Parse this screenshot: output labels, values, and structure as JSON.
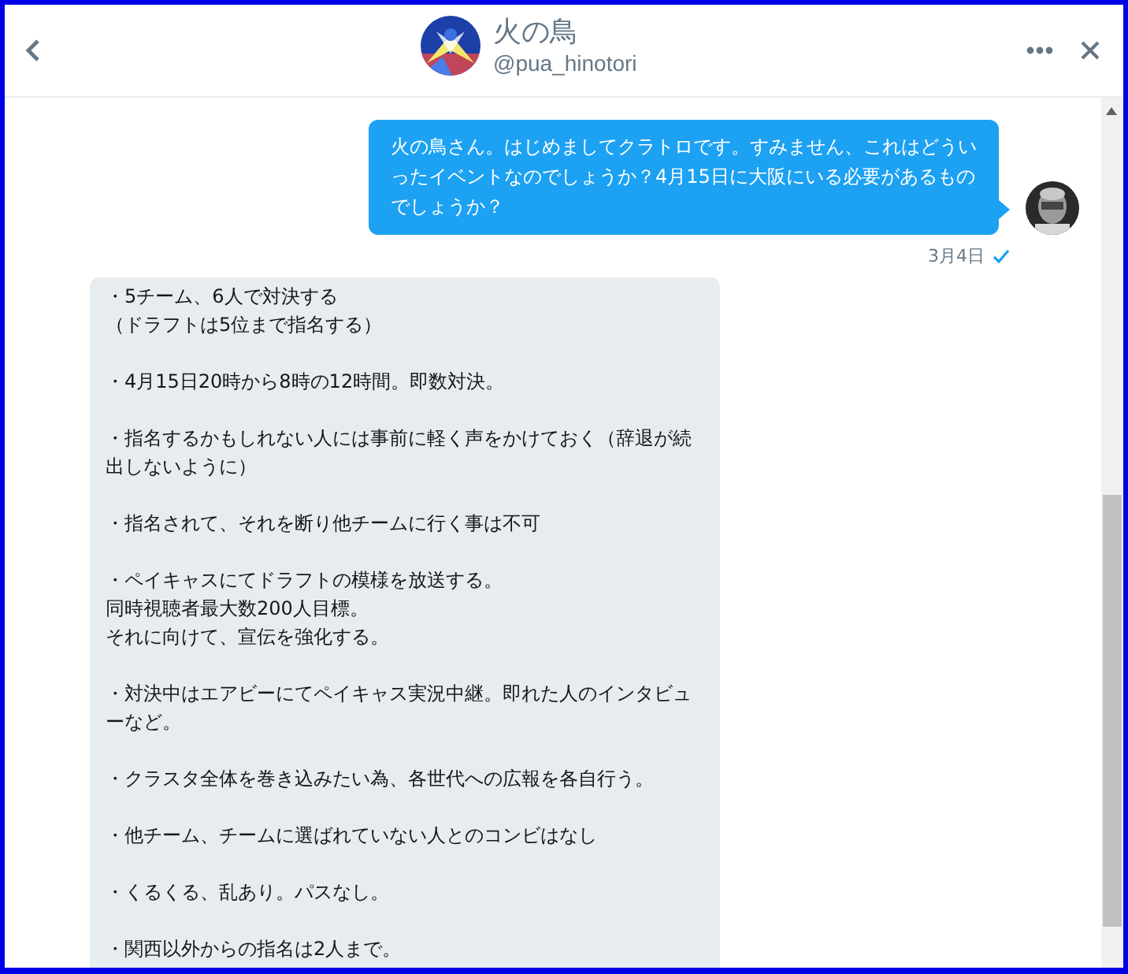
{
  "header": {
    "name": "火の鳥",
    "handle": "@pua_hinotori"
  },
  "messages": [
    {
      "kind": "sent",
      "paragraphs": [
        [
          "火の鳥さん。はじめましてクラトロです。すみません、これはどういったイベントなのでしょうか？4月15日に大阪にいる必要があるものでしょうか？"
        ]
      ],
      "time": "3月4日",
      "read": true
    },
    {
      "kind": "received",
      "paragraphs": [
        [
          "・5チーム、6人で対決する",
          "（ドラフトは5位まで指名する）"
        ],
        [
          "・4月15日20時から8時の12時間。即数対決。"
        ],
        [
          "・指名するかもしれない人には事前に軽く声をかけておく（辞退が続出しないように）"
        ],
        [
          "・指名されて、それを断り他チームに行く事は不可"
        ],
        [
          "・ペイキャスにてドラフトの模様を放送する。",
          "同時視聴者最大数200人目標。",
          "それに向けて、宣伝を強化する。"
        ],
        [
          "・対決中はエアビーにてペイキャス実況中継。即れた人のインタビューなど。"
        ],
        [
          "・クラスタ全体を巻き込みたい為、各世代への広報を各自行う。"
        ],
        [
          "・他チーム、チームに選ばれていない人とのコンビはなし"
        ],
        [
          "・くるくる、乱あり。パスなし。"
        ],
        [
          "・関西以外からの指名は2人まで。"
        ]
      ]
    }
  ]
}
